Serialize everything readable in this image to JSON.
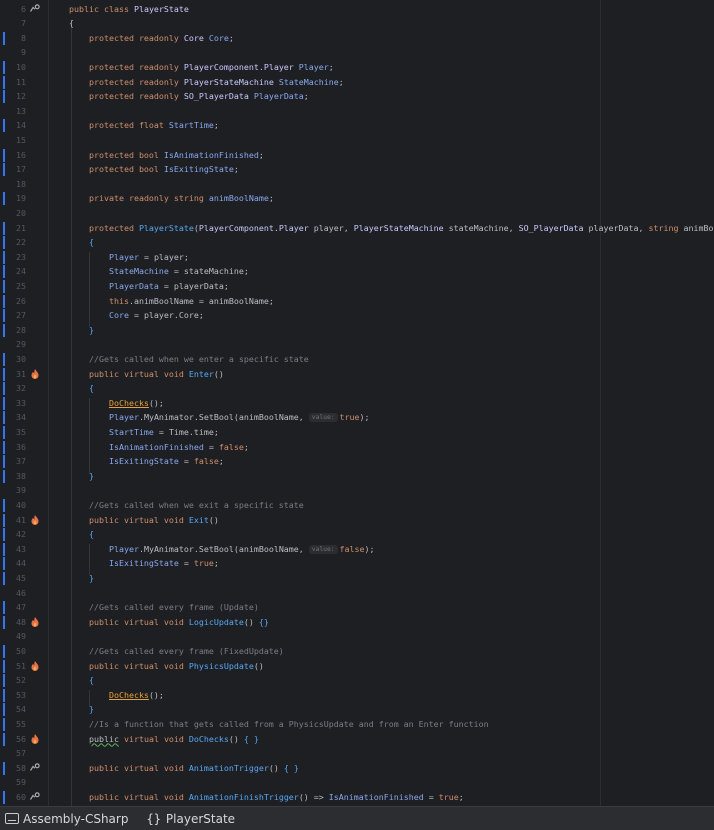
{
  "editor": {
    "lines": [
      {
        "n": "6",
        "mark": false,
        "icon": "implements",
        "tokens": [
          [
            "kw",
            "public "
          ],
          [
            "kw",
            "class "
          ],
          [
            "ty",
            "PlayerState"
          ]
        ]
      },
      {
        "n": "7",
        "mark": false,
        "icon": "",
        "tokens": [
          [
            "",
            "{"
          ]
        ]
      },
      {
        "n": "8",
        "mark": true,
        "icon": "",
        "tokens": [
          [
            "",
            "    "
          ],
          [
            "kw",
            "protected "
          ],
          [
            "kw",
            "readonly "
          ],
          [
            "ty",
            "Core "
          ],
          [
            "pr",
            "Core"
          ],
          [
            "",
            ";"
          ]
        ]
      },
      {
        "n": "9",
        "mark": false,
        "icon": "",
        "tokens": []
      },
      {
        "n": "10",
        "mark": true,
        "icon": "",
        "tokens": [
          [
            "",
            "    "
          ],
          [
            "kw",
            "protected "
          ],
          [
            "kw",
            "readonly "
          ],
          [
            "ty",
            "PlayerComponent.Player "
          ],
          [
            "pr",
            "Player"
          ],
          [
            "",
            ";"
          ]
        ]
      },
      {
        "n": "11",
        "mark": true,
        "icon": "",
        "tokens": [
          [
            "",
            "    "
          ],
          [
            "kw",
            "protected "
          ],
          [
            "kw",
            "readonly "
          ],
          [
            "ty",
            "PlayerStateMachine "
          ],
          [
            "pr",
            "StateMachine"
          ],
          [
            "",
            ";"
          ]
        ]
      },
      {
        "n": "12",
        "mark": true,
        "icon": "",
        "tokens": [
          [
            "",
            "    "
          ],
          [
            "kw",
            "protected "
          ],
          [
            "kw",
            "readonly "
          ],
          [
            "ty",
            "SO_PlayerData "
          ],
          [
            "pr",
            "PlayerData"
          ],
          [
            "",
            ";"
          ]
        ]
      },
      {
        "n": "13",
        "mark": false,
        "icon": "",
        "tokens": []
      },
      {
        "n": "14",
        "mark": true,
        "icon": "",
        "tokens": [
          [
            "",
            "    "
          ],
          [
            "kw",
            "protected "
          ],
          [
            "kw",
            "float "
          ],
          [
            "pr",
            "StartTime"
          ],
          [
            "",
            ";"
          ]
        ]
      },
      {
        "n": "15",
        "mark": false,
        "icon": "",
        "tokens": []
      },
      {
        "n": "16",
        "mark": true,
        "icon": "",
        "tokens": [
          [
            "",
            "    "
          ],
          [
            "kw",
            "protected "
          ],
          [
            "kw",
            "bool "
          ],
          [
            "pr",
            "IsAnimationFinished"
          ],
          [
            "",
            ";"
          ]
        ]
      },
      {
        "n": "17",
        "mark": true,
        "icon": "",
        "tokens": [
          [
            "",
            "    "
          ],
          [
            "kw",
            "protected "
          ],
          [
            "kw",
            "bool "
          ],
          [
            "pr",
            "IsExitingState"
          ],
          [
            "",
            ";"
          ]
        ]
      },
      {
        "n": "18",
        "mark": false,
        "icon": "",
        "tokens": []
      },
      {
        "n": "19",
        "mark": true,
        "icon": "",
        "tokens": [
          [
            "",
            "    "
          ],
          [
            "kw",
            "private "
          ],
          [
            "kw",
            "readonly "
          ],
          [
            "kw",
            "string "
          ],
          [
            "pr",
            "animBoolName"
          ],
          [
            "",
            ";"
          ]
        ]
      },
      {
        "n": "20",
        "mark": false,
        "icon": "",
        "tokens": []
      },
      {
        "n": "21",
        "mark": true,
        "icon": "",
        "tokens": [
          [
            "",
            "    "
          ],
          [
            "kw",
            "protected "
          ],
          [
            "fn",
            "PlayerState"
          ],
          [
            "",
            "("
          ],
          [
            "ty",
            "PlayerComponent.Player "
          ],
          [
            "",
            "player, "
          ],
          [
            "ty",
            "PlayerStateMachine "
          ],
          [
            "",
            "stateMachine, "
          ],
          [
            "ty",
            "SO_PlayerData "
          ],
          [
            "",
            "playerData, "
          ],
          [
            "kw",
            "string "
          ],
          [
            "",
            "animBoolName)"
          ]
        ]
      },
      {
        "n": "22",
        "mark": true,
        "icon": "",
        "tokens": [
          [
            "",
            "    "
          ],
          [
            "fn",
            "{"
          ]
        ]
      },
      {
        "n": "23",
        "mark": true,
        "icon": "",
        "tokens": [
          [
            "",
            "        "
          ],
          [
            "pr",
            "Player"
          ],
          [
            "",
            " = player;"
          ]
        ]
      },
      {
        "n": "24",
        "mark": true,
        "icon": "",
        "tokens": [
          [
            "",
            "        "
          ],
          [
            "pr",
            "StateMachine"
          ],
          [
            "",
            " = stateMachine;"
          ]
        ]
      },
      {
        "n": "25",
        "mark": true,
        "icon": "",
        "tokens": [
          [
            "",
            "        "
          ],
          [
            "pr",
            "PlayerData"
          ],
          [
            "",
            " = playerData;"
          ]
        ]
      },
      {
        "n": "26",
        "mark": true,
        "icon": "",
        "tokens": [
          [
            "",
            "        "
          ],
          [
            "kw",
            "this"
          ],
          [
            "",
            ".animBoolName = animBoolName;"
          ]
        ]
      },
      {
        "n": "27",
        "mark": true,
        "icon": "",
        "tokens": [
          [
            "",
            "        "
          ],
          [
            "pr",
            "Core"
          ],
          [
            "",
            " = player.Core;"
          ]
        ]
      },
      {
        "n": "28",
        "mark": true,
        "icon": "",
        "tokens": [
          [
            "",
            "    "
          ],
          [
            "fn",
            "}"
          ]
        ]
      },
      {
        "n": "29",
        "mark": false,
        "icon": "",
        "tokens": []
      },
      {
        "n": "30",
        "mark": true,
        "icon": "",
        "tokens": [
          [
            "",
            "    "
          ],
          [
            "cm",
            "//Gets called when we enter a specific state"
          ]
        ]
      },
      {
        "n": "31",
        "mark": true,
        "icon": "unity",
        "tokens": [
          [
            "",
            "    "
          ],
          [
            "kw",
            "public "
          ],
          [
            "kw",
            "virtual "
          ],
          [
            "kw",
            "void "
          ],
          [
            "fn",
            "Enter"
          ],
          [
            "",
            "()"
          ]
        ]
      },
      {
        "n": "32",
        "mark": true,
        "icon": "",
        "tokens": [
          [
            "",
            "    "
          ],
          [
            "fn",
            "{"
          ]
        ]
      },
      {
        "n": "33",
        "mark": true,
        "icon": "",
        "tokens": [
          [
            "",
            "        "
          ],
          [
            "un",
            "DoChecks"
          ],
          [
            "",
            "();"
          ]
        ]
      },
      {
        "n": "34",
        "mark": true,
        "icon": "",
        "tokens": [
          [
            "",
            "        "
          ],
          [
            "pr",
            "Player"
          ],
          [
            "",
            ".MyAnimator.SetBool(animBoolName, "
          ],
          [
            "hint",
            "value:"
          ],
          [
            "kw",
            "true"
          ],
          [
            "",
            ");"
          ]
        ]
      },
      {
        "n": "35",
        "mark": true,
        "icon": "",
        "tokens": [
          [
            "",
            "        "
          ],
          [
            "pr",
            "StartTime"
          ],
          [
            "",
            " = Time.time;"
          ]
        ]
      },
      {
        "n": "36",
        "mark": true,
        "icon": "",
        "tokens": [
          [
            "",
            "        "
          ],
          [
            "pr",
            "IsAnimationFinished"
          ],
          [
            "",
            " = "
          ],
          [
            "kw",
            "false"
          ],
          [
            "",
            ";"
          ]
        ]
      },
      {
        "n": "37",
        "mark": true,
        "icon": "",
        "tokens": [
          [
            "",
            "        "
          ],
          [
            "pr",
            "IsExitingState"
          ],
          [
            "",
            " = "
          ],
          [
            "kw",
            "false"
          ],
          [
            "",
            ";"
          ]
        ]
      },
      {
        "n": "38",
        "mark": true,
        "icon": "",
        "tokens": [
          [
            "",
            "    "
          ],
          [
            "fn",
            "}"
          ]
        ]
      },
      {
        "n": "39",
        "mark": false,
        "icon": "",
        "tokens": []
      },
      {
        "n": "40",
        "mark": true,
        "icon": "",
        "tokens": [
          [
            "",
            "    "
          ],
          [
            "cm",
            "//Gets called when we exit a specific state"
          ]
        ]
      },
      {
        "n": "41",
        "mark": true,
        "icon": "unity",
        "tokens": [
          [
            "",
            "    "
          ],
          [
            "kw",
            "public "
          ],
          [
            "kw",
            "virtual "
          ],
          [
            "kw",
            "void "
          ],
          [
            "fn",
            "Exit"
          ],
          [
            "",
            "()"
          ]
        ]
      },
      {
        "n": "42",
        "mark": true,
        "icon": "",
        "tokens": [
          [
            "",
            "    "
          ],
          [
            "fn",
            "{"
          ]
        ]
      },
      {
        "n": "43",
        "mark": true,
        "icon": "",
        "tokens": [
          [
            "",
            "        "
          ],
          [
            "pr",
            "Player"
          ],
          [
            "",
            ".MyAnimator.SetBool(animBoolName, "
          ],
          [
            "hint",
            "value:"
          ],
          [
            "kw",
            "false"
          ],
          [
            "",
            ");"
          ]
        ]
      },
      {
        "n": "44",
        "mark": true,
        "icon": "",
        "tokens": [
          [
            "",
            "        "
          ],
          [
            "pr",
            "IsExitingState"
          ],
          [
            "",
            " = "
          ],
          [
            "kw",
            "true"
          ],
          [
            "",
            ";"
          ]
        ]
      },
      {
        "n": "45",
        "mark": true,
        "icon": "",
        "tokens": [
          [
            "",
            "    "
          ],
          [
            "fn",
            "}"
          ]
        ]
      },
      {
        "n": "46",
        "mark": false,
        "icon": "",
        "tokens": []
      },
      {
        "n": "47",
        "mark": true,
        "icon": "",
        "tokens": [
          [
            "",
            "    "
          ],
          [
            "cm",
            "//Gets called every frame (Update)"
          ]
        ]
      },
      {
        "n": "48",
        "mark": true,
        "icon": "unity",
        "tokens": [
          [
            "",
            "    "
          ],
          [
            "kw",
            "public "
          ],
          [
            "kw",
            "virtual "
          ],
          [
            "kw",
            "void "
          ],
          [
            "fn",
            "LogicUpdate"
          ],
          [
            "",
            "() "
          ],
          [
            "fn",
            "{}"
          ]
        ]
      },
      {
        "n": "49",
        "mark": false,
        "icon": "",
        "tokens": []
      },
      {
        "n": "50",
        "mark": true,
        "icon": "",
        "tokens": [
          [
            "",
            "    "
          ],
          [
            "cm",
            "//Gets called every frame (FixedUpdate)"
          ]
        ]
      },
      {
        "n": "51",
        "mark": true,
        "icon": "unity",
        "tokens": [
          [
            "",
            "    "
          ],
          [
            "kw",
            "public "
          ],
          [
            "kw",
            "virtual "
          ],
          [
            "kw",
            "void "
          ],
          [
            "fn",
            "PhysicsUpdate"
          ],
          [
            "",
            "()"
          ]
        ]
      },
      {
        "n": "52",
        "mark": true,
        "icon": "",
        "tokens": [
          [
            "",
            "    "
          ],
          [
            "fn",
            "{"
          ]
        ]
      },
      {
        "n": "53",
        "mark": true,
        "icon": "",
        "tokens": [
          [
            "",
            "        "
          ],
          [
            "un",
            "DoChecks"
          ],
          [
            "",
            "();"
          ]
        ]
      },
      {
        "n": "54",
        "mark": true,
        "icon": "",
        "tokens": [
          [
            "",
            "    "
          ],
          [
            "fn",
            "}"
          ]
        ]
      },
      {
        "n": "55",
        "mark": true,
        "icon": "",
        "tokens": [
          [
            "",
            "    "
          ],
          [
            "cm",
            "//Is a function that gets called from a PhysicsUpdate and from an Enter function"
          ]
        ]
      },
      {
        "n": "56",
        "mark": true,
        "icon": "unity",
        "tokens": [
          [
            "",
            "    "
          ],
          [
            "sq",
            "public"
          ],
          [
            "",
            " "
          ],
          [
            "kw",
            "virtual "
          ],
          [
            "kw",
            "void "
          ],
          [
            "fn",
            "DoChecks"
          ],
          [
            "",
            "() "
          ],
          [
            "fn",
            "{ }"
          ]
        ]
      },
      {
        "n": "57",
        "mark": false,
        "icon": "",
        "tokens": []
      },
      {
        "n": "58",
        "mark": true,
        "icon": "implements",
        "tokens": [
          [
            "",
            "    "
          ],
          [
            "kw",
            "public "
          ],
          [
            "kw",
            "virtual "
          ],
          [
            "kw",
            "void "
          ],
          [
            "fn",
            "AnimationTrigger"
          ],
          [
            "",
            "() "
          ],
          [
            "fn",
            "{ }"
          ]
        ]
      },
      {
        "n": "59",
        "mark": false,
        "icon": "",
        "tokens": []
      },
      {
        "n": "60",
        "mark": true,
        "icon": "implements",
        "tokens": [
          [
            "",
            "    "
          ],
          [
            "kw",
            "public "
          ],
          [
            "kw",
            "virtual "
          ],
          [
            "kw",
            "void "
          ],
          [
            "fn",
            "AnimationFinishTrigger"
          ],
          [
            "",
            "() => "
          ],
          [
            "pr",
            "IsAnimationFinished"
          ],
          [
            "",
            " = "
          ],
          [
            "kw",
            "true"
          ],
          [
            "",
            ";"
          ]
        ]
      }
    ]
  },
  "statusbar": {
    "project_icon": "window-icon",
    "project": "Assembly-CSharp",
    "context_icon": "braces-icon",
    "context_glyph": "{}",
    "context": "PlayerState"
  },
  "colors": {
    "background": "#1e1f22",
    "keyword": "#cf8e6d",
    "type": "#c9c9ff",
    "property": "#88a8ef",
    "comment": "#7a7e85",
    "method": "#56a8f5",
    "gutter_mark": "#3574f0"
  }
}
